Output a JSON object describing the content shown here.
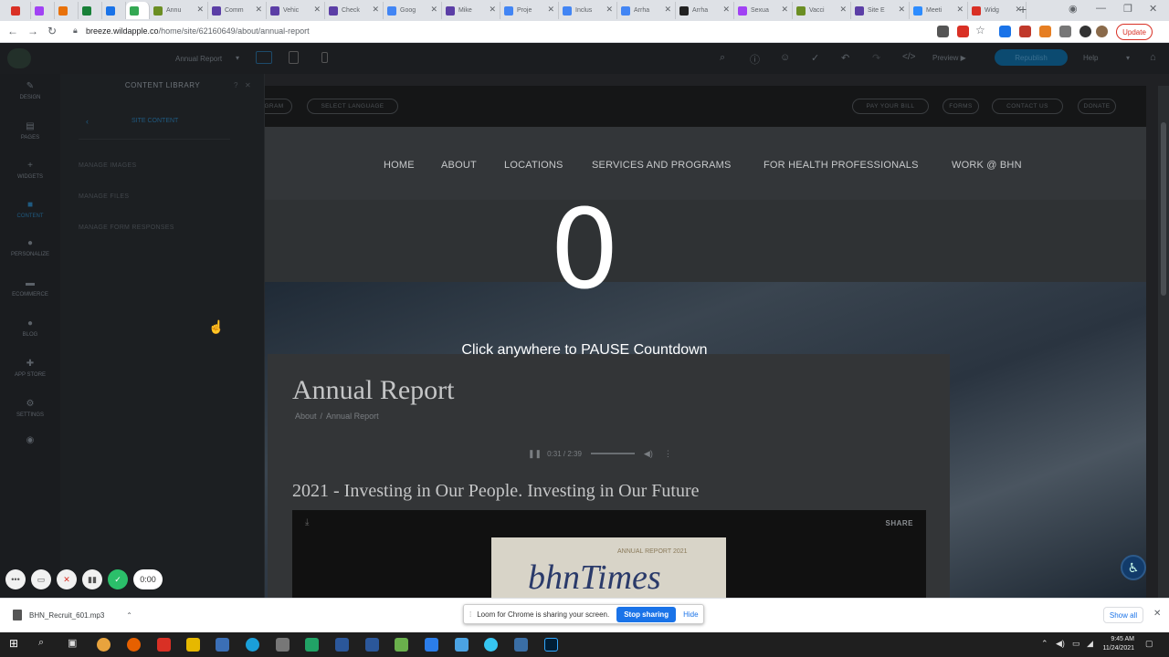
{
  "browser": {
    "tabs": [
      {
        "label": "",
        "color": "#d93025",
        "active": false
      },
      {
        "label": "",
        "color": "#a142f4",
        "active": false
      },
      {
        "label": "",
        "color": "#e8710a",
        "active": false
      },
      {
        "label": "",
        "color": "#188038",
        "active": false
      },
      {
        "label": "",
        "color": "#1a73e8",
        "active": false
      },
      {
        "label": "",
        "color": "#34a853",
        "active": true
      },
      {
        "label": "Annu",
        "color": "#6b8e23",
        "active": false
      },
      {
        "label": "Comm",
        "color": "#5b3ea6",
        "active": false
      },
      {
        "label": "Vehic",
        "color": "#5b3ea6",
        "active": false
      },
      {
        "label": "Check",
        "color": "#5b3ea6",
        "active": false
      },
      {
        "label": "Goog",
        "color": "#4285f4",
        "active": false
      },
      {
        "label": "Mike",
        "color": "#5b3ea6",
        "active": false
      },
      {
        "label": "Proje",
        "color": "#4285f4",
        "active": false
      },
      {
        "label": "Inclus",
        "color": "#4285f4",
        "active": false
      },
      {
        "label": "Arrha",
        "color": "#4285f4",
        "active": false
      },
      {
        "label": "Arrha",
        "color": "#222222",
        "active": false
      },
      {
        "label": "Sexua",
        "color": "#a142f4",
        "active": false
      },
      {
        "label": "Vacci",
        "color": "#6b8e23",
        "active": false
      },
      {
        "label": "Site E",
        "color": "#5b3ea6",
        "active": false
      },
      {
        "label": "Meeti",
        "color": "#2d8cff",
        "active": false
      },
      {
        "label": "Widg",
        "color": "#d93025",
        "active": false
      }
    ],
    "new_tab": "+",
    "url_host": "breeze.wildapple.co",
    "url_path": "/home/site/62160649/about/annual-report",
    "update_label": "Update"
  },
  "editor": {
    "page_select": "Annual Report",
    "preview_label": "Preview",
    "republish_label": "Republish",
    "help_label": "Help"
  },
  "left_sidebar": [
    {
      "label": "DESIGN",
      "icon": "brush-icon",
      "glyph": "✎"
    },
    {
      "label": "PAGES",
      "icon": "pages-icon",
      "glyph": "▤"
    },
    {
      "label": "WIDGETS",
      "icon": "plus-icon",
      "glyph": "+"
    },
    {
      "label": "CONTENT",
      "icon": "folder-icon",
      "glyph": "■"
    },
    {
      "label": "PERSONALIZE",
      "icon": "person-icon",
      "glyph": "●"
    },
    {
      "label": "ECOMMERCE",
      "icon": "cart-icon",
      "glyph": "▬"
    },
    {
      "label": "BLOG",
      "icon": "blog-icon",
      "glyph": "●"
    },
    {
      "label": "APP STORE",
      "icon": "puzzle-icon",
      "glyph": "✚"
    },
    {
      "label": "SETTINGS",
      "icon": "gear-icon",
      "glyph": "⚙"
    },
    {
      "label": "",
      "icon": "eye-icon",
      "glyph": "◉"
    }
  ],
  "content_panel": {
    "title": "CONTENT LIBRARY",
    "section": "SITE CONTENT",
    "links": [
      "MANAGE IMAGES",
      "MANAGE FILES",
      "MANAGE FORM RESPONSES"
    ]
  },
  "site": {
    "top_pills_left": [
      "GRAM",
      "SELECT LANGUAGE"
    ],
    "top_pills_right": [
      "PAY YOUR BILL",
      "FORMS",
      "CONTACT US",
      "DONATE"
    ],
    "nav": [
      "HOME",
      "ABOUT",
      "LOCATIONS",
      "SERVICES AND PROGRAMS",
      "FOR HEALTH PROFESSIONALS",
      "WORK @ BHN"
    ],
    "title": "Annual Report",
    "breadcrumb": {
      "parent": "About",
      "sep": "/",
      "current": "Annual Report"
    },
    "audio_time": "0:31 / 2:39",
    "subtitle": "2021 - Investing in Our People. Investing in Our Future",
    "share_label": "SHARE",
    "thumb_logo": "bhnTimes",
    "thumb_caption": "ANNUAL REPORT 2021"
  },
  "overlay": {
    "countdown": "0",
    "message": "Click anywhere to PAUSE Countdown"
  },
  "loom_controls": {
    "timer": "0:00"
  },
  "downloads": {
    "file": "BHN_Recruit_601.mp3",
    "show_all": "Show all"
  },
  "loom_banner": {
    "text": "Loom for Chrome is sharing your screen.",
    "stop": "Stop sharing",
    "hide": "Hide"
  },
  "taskbar": {
    "time": "9:45 AM",
    "date": "11/24/2021"
  }
}
